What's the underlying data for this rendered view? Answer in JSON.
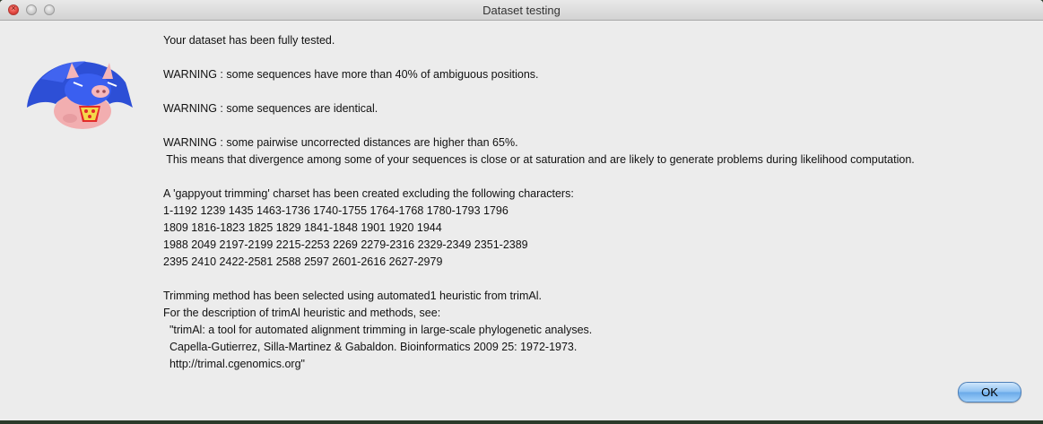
{
  "window": {
    "title": "Dataset testing"
  },
  "message": {
    "lines": [
      "Your dataset has been fully tested.",
      "",
      "WARNING : some sequences have more than 40% of ambiguous positions.",
      "",
      "WARNING : some sequences are identical.",
      "",
      "WARNING : some pairwise uncorrected distances are higher than 65%.",
      " This means that divergence among some of your sequences is close or at saturation and are likely to generate problems during likelihood computation.",
      "",
      "A 'gappyout trimming' charset has been created excluding the following characters:",
      "1-1192 1239 1435 1463-1736 1740-1755 1764-1768 1780-1793 1796",
      "1809 1816-1823 1825 1829 1841-1848 1901 1920 1944",
      "1988 2049 2197-2199 2215-2253 2269 2279-2316 2329-2349 2351-2389",
      "2395 2410 2422-2581 2588 2597 2601-2616 2627-2979",
      "",
      "Trimming method has been selected using automated1 heuristic from trimAl.",
      "For the description of trimAl heuristic and methods, see:",
      "  \"trimAl: a tool for automated alignment trimming in large-scale phylogenetic analyses.",
      "  Capella-Gutierrez, Silla-Martinez & Gabaldon. Bioinformatics 2009 25: 1972-1973.",
      "  http://trimal.cgenomics.org\""
    ]
  },
  "buttons": {
    "ok_label": "OK"
  },
  "icons": {
    "mascot": "superhero-pig-icon",
    "close": "close-icon",
    "minimize": "minimize-icon",
    "zoom": "zoom-icon"
  },
  "colors": {
    "window_bg": "#ececec",
    "close_red": "#e0443e",
    "ok_blue": "#8cc0f2"
  }
}
